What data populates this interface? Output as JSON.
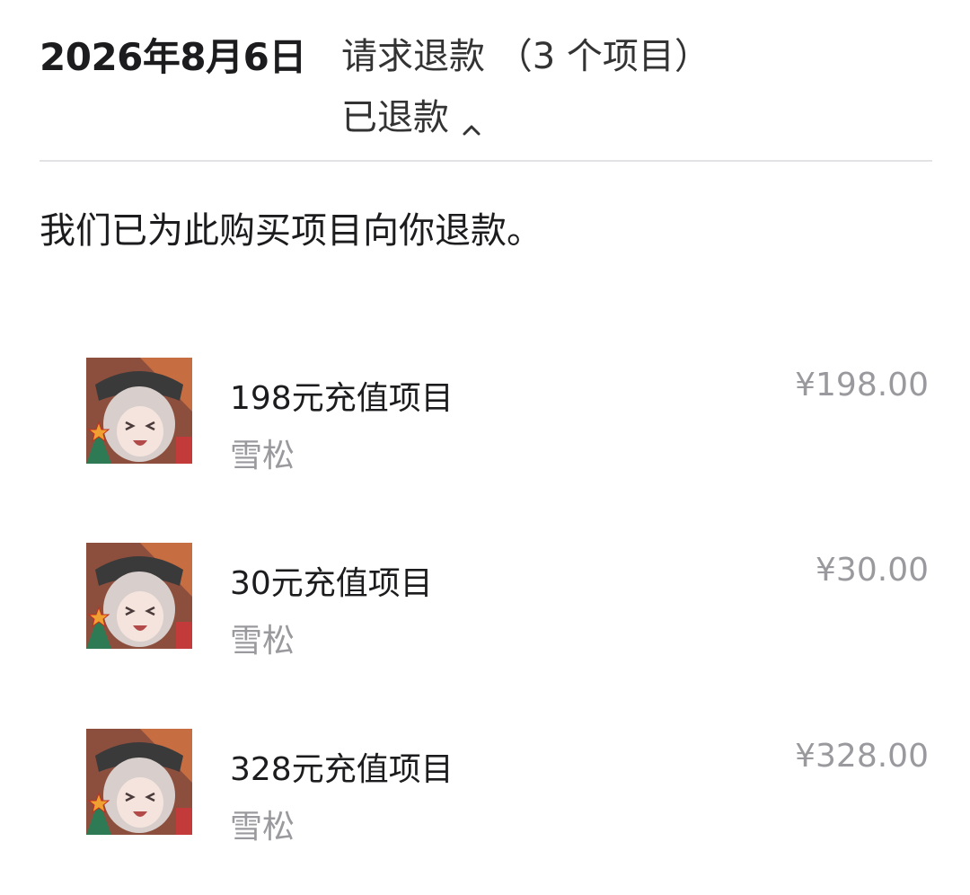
{
  "header": {
    "date": "2026年8月6日",
    "request_title": "请求退款 （3 个项目）",
    "status": "已退款"
  },
  "message": "我们已为此购买项目向你退款。",
  "items": [
    {
      "name": "198元充值项目",
      "subtitle": "雪松",
      "price": "¥198.00"
    },
    {
      "name": "30元充值项目",
      "subtitle": "雪松",
      "price": "¥30.00"
    },
    {
      "name": "328元充值项目",
      "subtitle": "雪松",
      "price": "¥328.00"
    }
  ],
  "icons": {
    "status_toggle": "chevron-up-icon",
    "item_thumbnail": "app-character-icon"
  },
  "colors": {
    "primary_text": "#1c1c1e",
    "secondary_text": "#9a9a9e",
    "divider": "#e3e3e6"
  }
}
